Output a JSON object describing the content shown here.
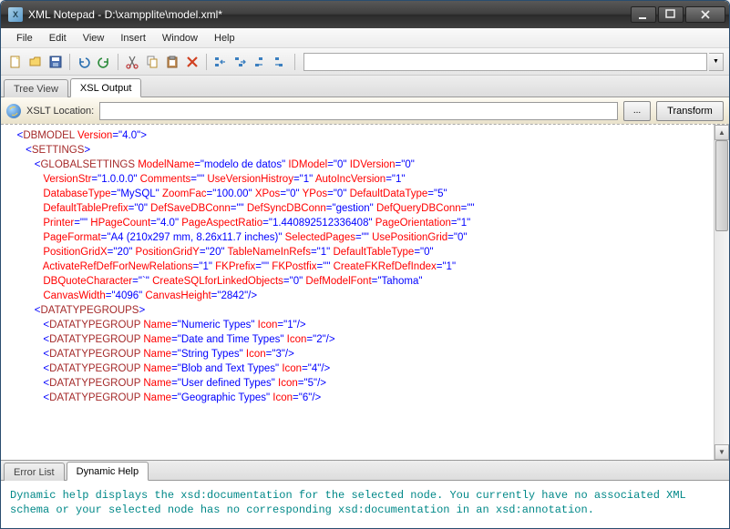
{
  "window": {
    "appIconLetter": "X",
    "title": "XML Notepad - D:\\xampplite\\model.xml*"
  },
  "menu": {
    "items": [
      "File",
      "Edit",
      "View",
      "Insert",
      "Window",
      "Help"
    ]
  },
  "tabs": {
    "main": [
      {
        "label": "Tree View",
        "active": false
      },
      {
        "label": "XSL Output",
        "active": true
      }
    ],
    "bottom": [
      {
        "label": "Error List",
        "active": false
      },
      {
        "label": "Dynamic Help",
        "active": true
      }
    ]
  },
  "xslt": {
    "label": "XSLT Location:",
    "value": "",
    "browse": "...",
    "transform": "Transform"
  },
  "xml": {
    "lines": [
      {
        "indent": 1,
        "tokens": [
          {
            "t": "pu",
            "v": "<"
          },
          {
            "t": "el",
            "v": "DBMODEL "
          },
          {
            "t": "at",
            "v": "Version"
          },
          {
            "t": "pu",
            "v": "=\""
          },
          {
            "t": "av",
            "v": "4.0"
          },
          {
            "t": "pu",
            "v": "\">"
          }
        ]
      },
      {
        "indent": 2,
        "tokens": [
          {
            "t": "pu",
            "v": "<"
          },
          {
            "t": "el",
            "v": "SETTINGS"
          },
          {
            "t": "pu",
            "v": ">"
          }
        ]
      },
      {
        "indent": 3,
        "tokens": [
          {
            "t": "pu",
            "v": "<"
          },
          {
            "t": "el",
            "v": "GLOBALSETTINGS "
          },
          {
            "t": "at",
            "v": "ModelName"
          },
          {
            "t": "pu",
            "v": "=\""
          },
          {
            "t": "av",
            "v": "modelo de datos"
          },
          {
            "t": "pu",
            "v": "\" "
          },
          {
            "t": "at",
            "v": "IDModel"
          },
          {
            "t": "pu",
            "v": "=\""
          },
          {
            "t": "av",
            "v": "0"
          },
          {
            "t": "pu",
            "v": "\" "
          },
          {
            "t": "at",
            "v": "IDVersion"
          },
          {
            "t": "pu",
            "v": "=\""
          },
          {
            "t": "av",
            "v": "0"
          },
          {
            "t": "pu",
            "v": "\""
          }
        ]
      },
      {
        "indent": 4,
        "tokens": [
          {
            "t": "at",
            "v": "VersionStr"
          },
          {
            "t": "pu",
            "v": "=\""
          },
          {
            "t": "av",
            "v": "1.0.0.0"
          },
          {
            "t": "pu",
            "v": "\" "
          },
          {
            "t": "at",
            "v": "Comments"
          },
          {
            "t": "pu",
            "v": "=\"\" "
          },
          {
            "t": "at",
            "v": "UseVersionHistroy"
          },
          {
            "t": "pu",
            "v": "=\""
          },
          {
            "t": "av",
            "v": "1"
          },
          {
            "t": "pu",
            "v": "\" "
          },
          {
            "t": "at",
            "v": "AutoIncVersion"
          },
          {
            "t": "pu",
            "v": "=\""
          },
          {
            "t": "av",
            "v": "1"
          },
          {
            "t": "pu",
            "v": "\""
          }
        ]
      },
      {
        "indent": 4,
        "tokens": [
          {
            "t": "at",
            "v": "DatabaseType"
          },
          {
            "t": "pu",
            "v": "=\""
          },
          {
            "t": "av",
            "v": "MySQL"
          },
          {
            "t": "pu",
            "v": "\" "
          },
          {
            "t": "at",
            "v": "ZoomFac"
          },
          {
            "t": "pu",
            "v": "=\""
          },
          {
            "t": "av",
            "v": "100.00"
          },
          {
            "t": "pu",
            "v": "\" "
          },
          {
            "t": "at",
            "v": "XPos"
          },
          {
            "t": "pu",
            "v": "=\""
          },
          {
            "t": "av",
            "v": "0"
          },
          {
            "t": "pu",
            "v": "\" "
          },
          {
            "t": "at",
            "v": "YPos"
          },
          {
            "t": "pu",
            "v": "=\""
          },
          {
            "t": "av",
            "v": "0"
          },
          {
            "t": "pu",
            "v": "\" "
          },
          {
            "t": "at",
            "v": "DefaultDataType"
          },
          {
            "t": "pu",
            "v": "=\""
          },
          {
            "t": "av",
            "v": "5"
          },
          {
            "t": "pu",
            "v": "\""
          }
        ]
      },
      {
        "indent": 4,
        "tokens": [
          {
            "t": "at",
            "v": "DefaultTablePrefix"
          },
          {
            "t": "pu",
            "v": "=\""
          },
          {
            "t": "av",
            "v": "0"
          },
          {
            "t": "pu",
            "v": "\" "
          },
          {
            "t": "at",
            "v": "DefSaveDBConn"
          },
          {
            "t": "pu",
            "v": "=\"\" "
          },
          {
            "t": "at",
            "v": "DefSyncDBConn"
          },
          {
            "t": "pu",
            "v": "=\""
          },
          {
            "t": "av",
            "v": "gestion"
          },
          {
            "t": "pu",
            "v": "\" "
          },
          {
            "t": "at",
            "v": "DefQueryDBConn"
          },
          {
            "t": "pu",
            "v": "=\"\""
          }
        ]
      },
      {
        "indent": 4,
        "tokens": [
          {
            "t": "at",
            "v": "Printer"
          },
          {
            "t": "pu",
            "v": "=\"\" "
          },
          {
            "t": "at",
            "v": "HPageCount"
          },
          {
            "t": "pu",
            "v": "=\""
          },
          {
            "t": "av",
            "v": "4.0"
          },
          {
            "t": "pu",
            "v": "\" "
          },
          {
            "t": "at",
            "v": "PageAspectRatio"
          },
          {
            "t": "pu",
            "v": "=\""
          },
          {
            "t": "av",
            "v": "1.440892512336408"
          },
          {
            "t": "pu",
            "v": "\" "
          },
          {
            "t": "at",
            "v": "PageOrientation"
          },
          {
            "t": "pu",
            "v": "=\""
          },
          {
            "t": "av",
            "v": "1"
          },
          {
            "t": "pu",
            "v": "\""
          }
        ]
      },
      {
        "indent": 4,
        "tokens": [
          {
            "t": "at",
            "v": "PageFormat"
          },
          {
            "t": "pu",
            "v": "=\""
          },
          {
            "t": "av",
            "v": "A4 (210x297 mm, 8.26x11.7 inches)"
          },
          {
            "t": "pu",
            "v": "\" "
          },
          {
            "t": "at",
            "v": "SelectedPages"
          },
          {
            "t": "pu",
            "v": "=\"\" "
          },
          {
            "t": "at",
            "v": "UsePositionGrid"
          },
          {
            "t": "pu",
            "v": "=\""
          },
          {
            "t": "av",
            "v": "0"
          },
          {
            "t": "pu",
            "v": "\""
          }
        ]
      },
      {
        "indent": 4,
        "tokens": [
          {
            "t": "at",
            "v": "PositionGridX"
          },
          {
            "t": "pu",
            "v": "=\""
          },
          {
            "t": "av",
            "v": "20"
          },
          {
            "t": "pu",
            "v": "\" "
          },
          {
            "t": "at",
            "v": "PositionGridY"
          },
          {
            "t": "pu",
            "v": "=\""
          },
          {
            "t": "av",
            "v": "20"
          },
          {
            "t": "pu",
            "v": "\" "
          },
          {
            "t": "at",
            "v": "TableNameInRefs"
          },
          {
            "t": "pu",
            "v": "=\""
          },
          {
            "t": "av",
            "v": "1"
          },
          {
            "t": "pu",
            "v": "\" "
          },
          {
            "t": "at",
            "v": "DefaultTableType"
          },
          {
            "t": "pu",
            "v": "=\""
          },
          {
            "t": "av",
            "v": "0"
          },
          {
            "t": "pu",
            "v": "\""
          }
        ]
      },
      {
        "indent": 4,
        "tokens": [
          {
            "t": "at",
            "v": "ActivateRefDefForNewRelations"
          },
          {
            "t": "pu",
            "v": "=\""
          },
          {
            "t": "av",
            "v": "1"
          },
          {
            "t": "pu",
            "v": "\" "
          },
          {
            "t": "at",
            "v": "FKPrefix"
          },
          {
            "t": "pu",
            "v": "=\"\" "
          },
          {
            "t": "at",
            "v": "FKPostfix"
          },
          {
            "t": "pu",
            "v": "=\"\" "
          },
          {
            "t": "at",
            "v": "CreateFKRefDefIndex"
          },
          {
            "t": "pu",
            "v": "=\""
          },
          {
            "t": "av",
            "v": "1"
          },
          {
            "t": "pu",
            "v": "\""
          }
        ]
      },
      {
        "indent": 4,
        "tokens": [
          {
            "t": "at",
            "v": "DBQuoteCharacter"
          },
          {
            "t": "pu",
            "v": "=\""
          },
          {
            "t": "av",
            "v": "`"
          },
          {
            "t": "pu",
            "v": "\" "
          },
          {
            "t": "at",
            "v": "CreateSQLforLinkedObjects"
          },
          {
            "t": "pu",
            "v": "=\""
          },
          {
            "t": "av",
            "v": "0"
          },
          {
            "t": "pu",
            "v": "\" "
          },
          {
            "t": "at",
            "v": "DefModelFont"
          },
          {
            "t": "pu",
            "v": "=\""
          },
          {
            "t": "av",
            "v": "Tahoma"
          },
          {
            "t": "pu",
            "v": "\""
          }
        ]
      },
      {
        "indent": 4,
        "tokens": [
          {
            "t": "at",
            "v": "CanvasWidth"
          },
          {
            "t": "pu",
            "v": "=\""
          },
          {
            "t": "av",
            "v": "4096"
          },
          {
            "t": "pu",
            "v": "\" "
          },
          {
            "t": "at",
            "v": "CanvasHeight"
          },
          {
            "t": "pu",
            "v": "=\""
          },
          {
            "t": "av",
            "v": "2842"
          },
          {
            "t": "pu",
            "v": "\"/>"
          }
        ]
      },
      {
        "indent": 3,
        "tokens": [
          {
            "t": "pu",
            "v": "<"
          },
          {
            "t": "el",
            "v": "DATATYPEGROUPS"
          },
          {
            "t": "pu",
            "v": ">"
          }
        ]
      },
      {
        "indent": 4,
        "tokens": [
          {
            "t": "pu",
            "v": "<"
          },
          {
            "t": "el",
            "v": "DATATYPEGROUP "
          },
          {
            "t": "at",
            "v": "Name"
          },
          {
            "t": "pu",
            "v": "=\""
          },
          {
            "t": "av",
            "v": "Numeric Types"
          },
          {
            "t": "pu",
            "v": "\" "
          },
          {
            "t": "at",
            "v": "Icon"
          },
          {
            "t": "pu",
            "v": "=\""
          },
          {
            "t": "av",
            "v": "1"
          },
          {
            "t": "pu",
            "v": "\"/>"
          }
        ]
      },
      {
        "indent": 4,
        "tokens": [
          {
            "t": "pu",
            "v": "<"
          },
          {
            "t": "el",
            "v": "DATATYPEGROUP "
          },
          {
            "t": "at",
            "v": "Name"
          },
          {
            "t": "pu",
            "v": "=\""
          },
          {
            "t": "av",
            "v": "Date and Time Types"
          },
          {
            "t": "pu",
            "v": "\" "
          },
          {
            "t": "at",
            "v": "Icon"
          },
          {
            "t": "pu",
            "v": "=\""
          },
          {
            "t": "av",
            "v": "2"
          },
          {
            "t": "pu",
            "v": "\"/>"
          }
        ]
      },
      {
        "indent": 4,
        "tokens": [
          {
            "t": "pu",
            "v": "<"
          },
          {
            "t": "el",
            "v": "DATATYPEGROUP "
          },
          {
            "t": "at",
            "v": "Name"
          },
          {
            "t": "pu",
            "v": "=\""
          },
          {
            "t": "av",
            "v": "String Types"
          },
          {
            "t": "pu",
            "v": "\" "
          },
          {
            "t": "at",
            "v": "Icon"
          },
          {
            "t": "pu",
            "v": "=\""
          },
          {
            "t": "av",
            "v": "3"
          },
          {
            "t": "pu",
            "v": "\"/>"
          }
        ]
      },
      {
        "indent": 4,
        "tokens": [
          {
            "t": "pu",
            "v": "<"
          },
          {
            "t": "el",
            "v": "DATATYPEGROUP "
          },
          {
            "t": "at",
            "v": "Name"
          },
          {
            "t": "pu",
            "v": "=\""
          },
          {
            "t": "av",
            "v": "Blob and Text Types"
          },
          {
            "t": "pu",
            "v": "\" "
          },
          {
            "t": "at",
            "v": "Icon"
          },
          {
            "t": "pu",
            "v": "=\""
          },
          {
            "t": "av",
            "v": "4"
          },
          {
            "t": "pu",
            "v": "\"/>"
          }
        ]
      },
      {
        "indent": 4,
        "tokens": [
          {
            "t": "pu",
            "v": "<"
          },
          {
            "t": "el",
            "v": "DATATYPEGROUP "
          },
          {
            "t": "at",
            "v": "Name"
          },
          {
            "t": "pu",
            "v": "=\""
          },
          {
            "t": "av",
            "v": "User defined Types"
          },
          {
            "t": "pu",
            "v": "\" "
          },
          {
            "t": "at",
            "v": "Icon"
          },
          {
            "t": "pu",
            "v": "=\""
          },
          {
            "t": "av",
            "v": "5"
          },
          {
            "t": "pu",
            "v": "\"/>"
          }
        ]
      },
      {
        "indent": 4,
        "tokens": [
          {
            "t": "pu",
            "v": "<"
          },
          {
            "t": "el",
            "v": "DATATYPEGROUP "
          },
          {
            "t": "at",
            "v": "Name"
          },
          {
            "t": "pu",
            "v": "=\""
          },
          {
            "t": "av",
            "v": "Geographic Types"
          },
          {
            "t": "pu",
            "v": "\" "
          },
          {
            "t": "at",
            "v": "Icon"
          },
          {
            "t": "pu",
            "v": "=\""
          },
          {
            "t": "av",
            "v": "6"
          },
          {
            "t": "pu",
            "v": "\"/>"
          }
        ]
      }
    ]
  },
  "help": {
    "text": "Dynamic help displays the xsd:documentation for the selected node. You currently have no associated XML schema or your selected node has no corresponding xsd:documentation in an xsd:annotation."
  },
  "toolbarIcons": [
    "new",
    "open",
    "save",
    "undo",
    "redo",
    "cut",
    "copy",
    "paste",
    "delete",
    "outdent",
    "indent",
    "nest-out",
    "nest-in"
  ]
}
